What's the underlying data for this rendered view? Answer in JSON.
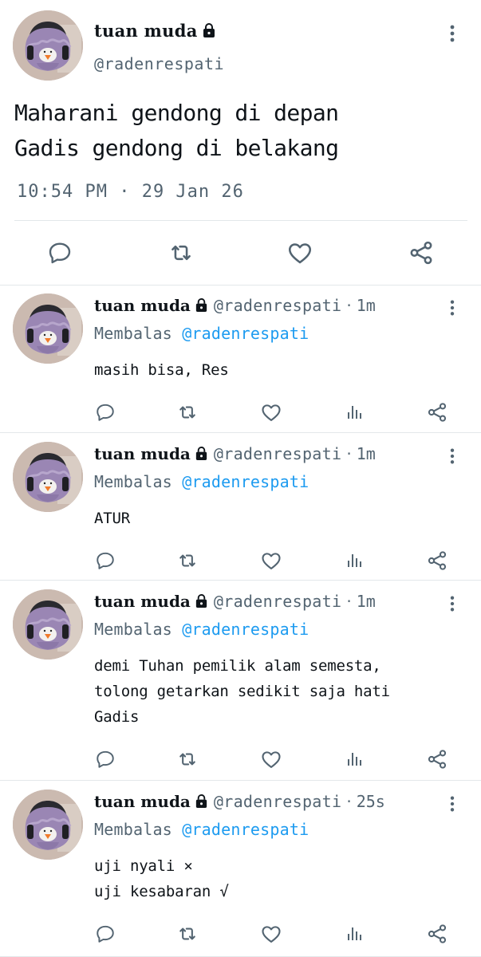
{
  "main_tweet": {
    "display_name": "tuan muda",
    "handle": "@radenrespati",
    "text": "Maharani gendong di depan\nGadis gendong di belakang",
    "timestamp": "10:54 PM · 29 Jan 26"
  },
  "replies": [
    {
      "display_name": "tuan muda",
      "handle": "@radenrespati",
      "dot": "·",
      "time": "1m",
      "replying_prefix": "Membalas",
      "replying_to": "@radenrespati",
      "text": "masih bisa, Res"
    },
    {
      "display_name": "tuan muda",
      "handle": "@radenrespati",
      "dot": "·",
      "time": "1m",
      "replying_prefix": "Membalas",
      "replying_to": "@radenrespati",
      "text": "ATUR"
    },
    {
      "display_name": "tuan muda",
      "handle": "@radenrespati",
      "dot": "·",
      "time": "1m",
      "replying_prefix": "Membalas",
      "replying_to": "@radenrespati",
      "text": "demi Tuhan pemilik alam semesta,\ntolong getarkan sedikit saja hati\nGadis"
    },
    {
      "display_name": "tuan muda",
      "handle": "@radenrespati",
      "dot": "·",
      "time": "25s",
      "replying_prefix": "Membalas",
      "replying_to": "@radenrespati",
      "text": "uji nyali ×\nuji kesabaran √"
    }
  ],
  "icons": {
    "lock": "lock-icon",
    "more": "more-vertical-icon",
    "reply": "reply-icon",
    "retweet": "retweet-icon",
    "like": "heart-icon",
    "views": "views-icon",
    "share": "share-icon"
  },
  "colors": {
    "text": "#0f1419",
    "secondary": "#536471",
    "mention": "#1d9bf0",
    "divider": "#e3e7ea"
  }
}
